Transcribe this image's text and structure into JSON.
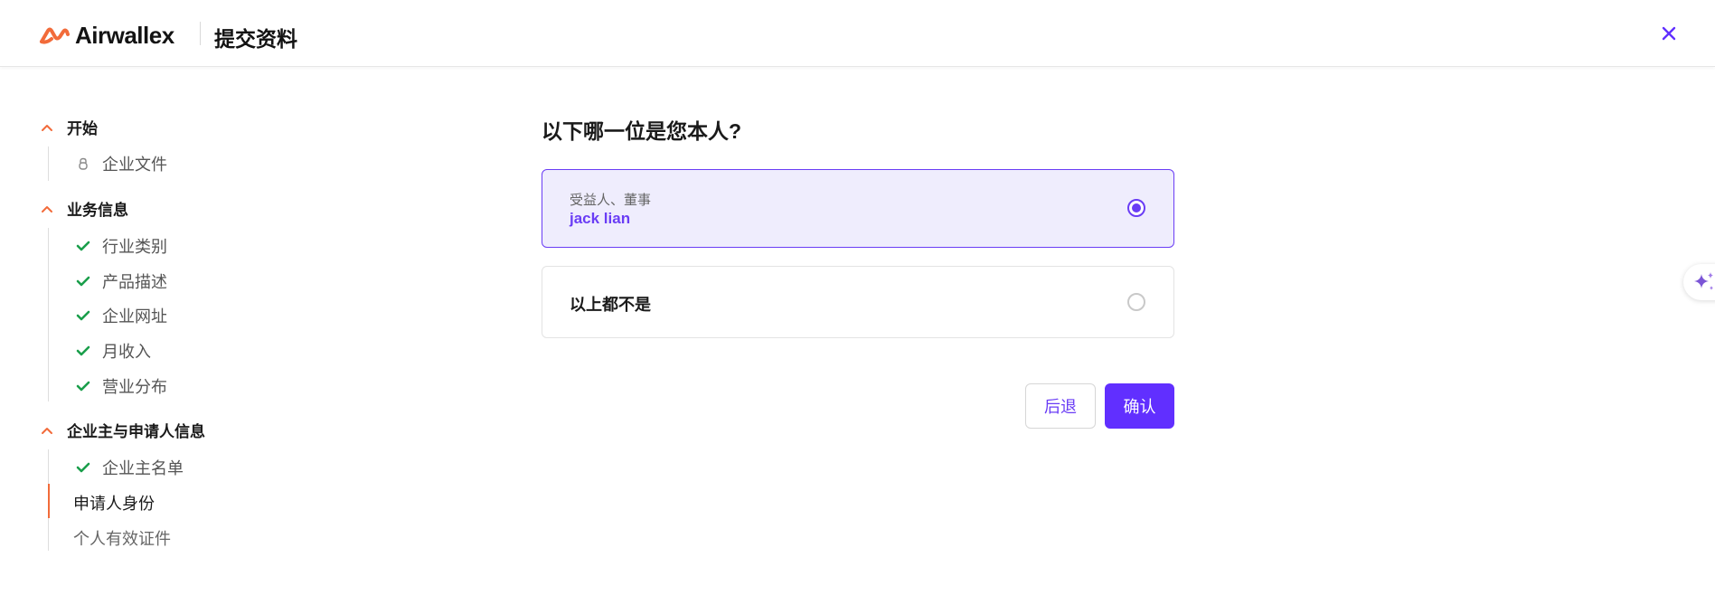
{
  "header": {
    "brand": "Airwallex",
    "title": "提交资料"
  },
  "sidebar": {
    "sections": [
      {
        "label": "开始",
        "items": [
          {
            "label": "企业文件",
            "status": "locked"
          }
        ]
      },
      {
        "label": "业务信息",
        "items": [
          {
            "label": "行业类别",
            "status": "done"
          },
          {
            "label": "产品描述",
            "status": "done"
          },
          {
            "label": "企业网址",
            "status": "done"
          },
          {
            "label": "月收入",
            "status": "done"
          },
          {
            "label": "营业分布",
            "status": "done"
          }
        ]
      },
      {
        "label": "企业主与申请人信息",
        "items": [
          {
            "label": "企业主名单",
            "status": "done"
          },
          {
            "label": "申请人身份",
            "status": "current"
          },
          {
            "label": "个人有效证件",
            "status": "pending"
          }
        ]
      }
    ]
  },
  "main": {
    "question": "以下哪一位是您本人?",
    "options": [
      {
        "role": "受益人、董事",
        "name": "jack lian",
        "selected": true
      },
      {
        "label": "以上都不是",
        "selected": false
      }
    ],
    "back_label": "后退",
    "confirm_label": "确认"
  },
  "colors": {
    "accent": "#612fff",
    "brand_orange": "#f26b3a",
    "success_green": "#1a9e4b"
  }
}
